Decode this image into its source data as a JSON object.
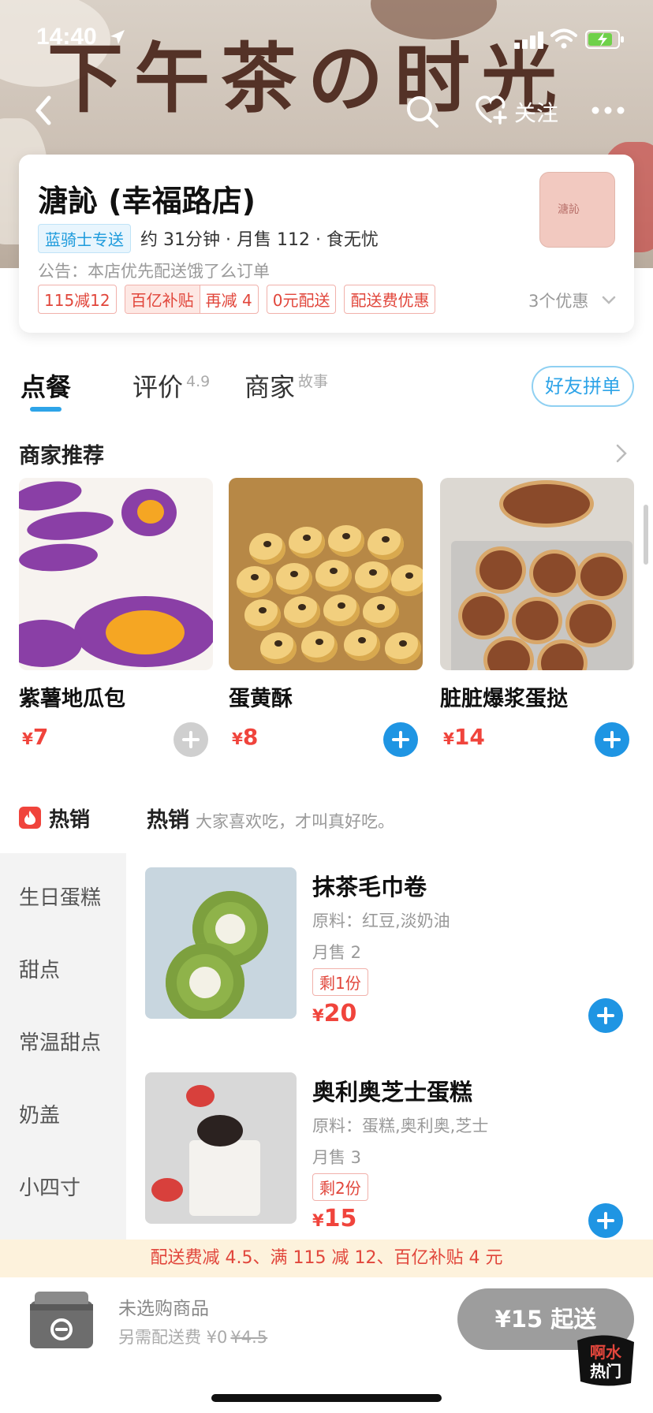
{
  "status_bar": {
    "time": "14:40"
  },
  "banner": {
    "art_text": "下午茶の时光"
  },
  "nav": {
    "follow_label": "关注"
  },
  "shop": {
    "name": "溏訫 (幸福路店)",
    "logo_text": "溏訫",
    "rider_badge": "蓝骑士专送",
    "meta": "约 31分钟 · 月售 112 · 食无忧",
    "notice": "公告：本店优先配送饿了么订单",
    "promos": [
      "115减12",
      "0元配送",
      "配送费优惠"
    ],
    "subsidy_left": "百亿补贴",
    "subsidy_right": "再减 4",
    "offers_count": "3个优惠"
  },
  "tabs": {
    "order": "点餐",
    "review": "评价",
    "review_score": "4.9",
    "merchant": "商家",
    "merchant_sub": "故事",
    "group_button": "好友拼单"
  },
  "recommended": {
    "title": "商家推荐",
    "items": [
      {
        "name": "紫薯地瓜包",
        "currency": "¥",
        "price": "7",
        "image": "purple-sweet-potato-bun",
        "add_enabled": false
      },
      {
        "name": "蛋黄酥",
        "currency": "¥",
        "price": "8",
        "image": "egg-yolk-pastry",
        "add_enabled": true
      },
      {
        "name": "脏脏爆浆蛋挞",
        "currency": "¥",
        "price": "14",
        "image": "dirty-lava-egg-tart",
        "add_enabled": true
      }
    ]
  },
  "hot": {
    "sidebar_label": "热销",
    "heading": "热销",
    "subtitle": "大家喜欢吃，才叫真好吃。"
  },
  "sidebar": {
    "categories": [
      "生日蛋糕",
      "甜点",
      "常温甜点",
      "奶盖",
      "小四寸"
    ]
  },
  "products": [
    {
      "name": "抹茶毛巾卷",
      "ingredients": "原料：红豆,淡奶油",
      "sales": "月售 2",
      "stock": "剩1份",
      "currency": "¥",
      "price": "20",
      "image": "matcha-towel-roll"
    },
    {
      "name": "奥利奥芝士蛋糕",
      "ingredients": "原料：蛋糕,奥利奥,芝士",
      "sales": "月售 3",
      "stock": "剩2份",
      "currency": "¥",
      "price": "15",
      "image": "oreo-cheesecake"
    }
  ],
  "discount_bar": "配送费减 4.5、满 115 减 12、百亿补贴 4 元",
  "cart": {
    "empty_text": "未选购商品",
    "fee_prefix": "另需配送费 ¥0",
    "fee_original": "¥4.5",
    "checkout": "¥15 起送"
  },
  "watermark": {
    "line1": "啊水",
    "line2": "热门"
  },
  "colors": {
    "accent_blue": "#1f95e3",
    "price_red": "#f0443c",
    "promo_red": "#e1463b",
    "checkout_gray": "#9d9d9d"
  }
}
